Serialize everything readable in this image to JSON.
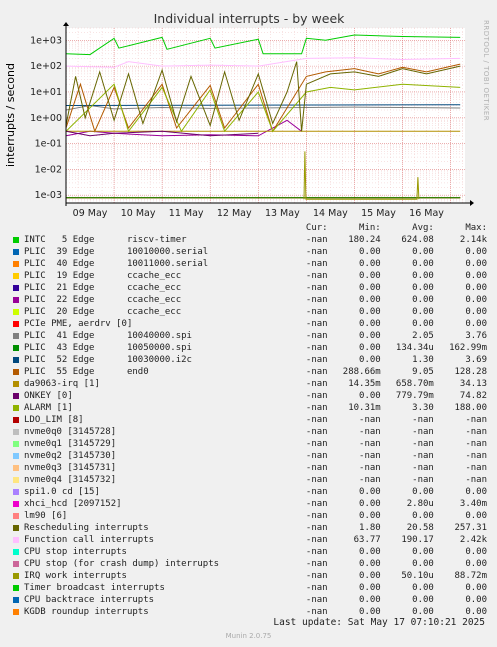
{
  "chart_data": {
    "type": "line",
    "title": "Individual interrupts - by week",
    "ylabel": "interrupts / second",
    "yscale": "log",
    "ylim": [
      0.0005,
      3000
    ],
    "yticks": [
      "1e+03",
      "1e+02",
      "1e+01",
      "1e+00",
      "1e-01",
      "1e-02",
      "1e-03"
    ],
    "ytick_values": [
      1000,
      100,
      10,
      1,
      0.1,
      0.01,
      0.001
    ],
    "xticks": [
      "09 May",
      "10 May",
      "11 May",
      "12 May",
      "13 May",
      "14 May",
      "15 May",
      "16 May"
    ],
    "xlim_days": [
      0,
      8.3
    ],
    "grid": true,
    "watermark": "RRDTOOL / TOBI OETIKER",
    "series": [
      {
        "name": "INTC   5 Edge      riscv-timer",
        "color": "#00cc00",
        "points": [
          [
            0,
            300
          ],
          [
            0.5,
            280
          ],
          [
            1.0,
            1200
          ],
          [
            1.1,
            500
          ],
          [
            2.0,
            1300
          ],
          [
            2.1,
            450
          ],
          [
            3.0,
            1200
          ],
          [
            3.1,
            500
          ],
          [
            4.0,
            1100
          ],
          [
            4.1,
            300
          ],
          [
            4.9,
            300
          ],
          [
            5.0,
            1200
          ],
          [
            5.4,
            1000
          ],
          [
            6.0,
            1600
          ],
          [
            7.0,
            1400
          ],
          [
            8.2,
            1300
          ]
        ]
      },
      {
        "name": "PLIC  39 Edge      10010000.serial",
        "color": "#0066b3",
        "points": [
          [
            0,
            0.0008
          ],
          [
            8.2,
            0.0008
          ]
        ]
      },
      {
        "name": "PLIC  40 Edge      10011000.serial",
        "color": "#ff8000",
        "points": [
          [
            0,
            0.0008
          ],
          [
            8.2,
            0.0008
          ]
        ]
      },
      {
        "name": "PLIC  19 Edge      ccache_ecc",
        "color": "#ffcc00",
        "points": [
          [
            0,
            0.0008
          ],
          [
            8.2,
            0.0008
          ]
        ]
      },
      {
        "name": "PLIC  21 Edge      ccache_ecc",
        "color": "#330099",
        "points": [
          [
            0,
            0.0008
          ],
          [
            8.2,
            0.0008
          ]
        ]
      },
      {
        "name": "PLIC  22 Edge      ccache_ecc",
        "color": "#990099",
        "points": [
          [
            0,
            0.2
          ],
          [
            0.5,
            0.3
          ],
          [
            1.0,
            0.25
          ],
          [
            2.0,
            0.2
          ],
          [
            3.0,
            0.22
          ],
          [
            4.0,
            0.2
          ],
          [
            4.6,
            0.8
          ],
          [
            4.9,
            0.3
          ]
        ]
      },
      {
        "name": "PLIC  20 Edge      ccache_ecc",
        "color": "#ccff00",
        "points": [
          [
            0,
            0.0008
          ],
          [
            8.2,
            0.0008
          ]
        ]
      },
      {
        "name": "PCIe PME, aerdrv [0]",
        "color": "#ff0000",
        "points": [
          [
            0,
            0.0008
          ],
          [
            8.2,
            0.0008
          ]
        ]
      },
      {
        "name": "PLIC  41 Edge      10040000.spi",
        "color": "#808080",
        "points": [
          [
            0,
            2.0
          ],
          [
            0.5,
            3.0
          ],
          [
            1.0,
            2.2
          ],
          [
            2.0,
            2.5
          ],
          [
            3.0,
            2.3
          ],
          [
            4.0,
            2.4
          ],
          [
            5.0,
            2.5
          ],
          [
            6.0,
            2.6
          ],
          [
            7.0,
            2.5
          ],
          [
            8.2,
            2.4
          ]
        ]
      },
      {
        "name": "PLIC  43 Edge      10050000.spi",
        "color": "#008f00",
        "points": [
          [
            0,
            0.0008
          ],
          [
            8.2,
            0.0008
          ]
        ]
      },
      {
        "name": "PLIC  52 Edge      10030000.i2c",
        "color": "#00487d",
        "points": [
          [
            0,
            3.0
          ],
          [
            8.2,
            3.2
          ]
        ]
      },
      {
        "name": "PLIC  55 Edge      end0",
        "color": "#b35a00",
        "points": [
          [
            0,
            0.4
          ],
          [
            0.3,
            20
          ],
          [
            0.6,
            0.3
          ],
          [
            1.0,
            15
          ],
          [
            1.3,
            0.4
          ],
          [
            2.0,
            20
          ],
          [
            2.3,
            0.4
          ],
          [
            3.0,
            18
          ],
          [
            3.3,
            0.4
          ],
          [
            4.0,
            20
          ],
          [
            4.3,
            0.3
          ],
          [
            5.0,
            40
          ],
          [
            5.4,
            60
          ],
          [
            6.0,
            80
          ],
          [
            6.5,
            50
          ],
          [
            7.0,
            90
          ],
          [
            7.5,
            60
          ],
          [
            8.2,
            120
          ]
        ]
      },
      {
        "name": "da9063-irq [1]",
        "color": "#b38f00",
        "points": [
          [
            0,
            0.3
          ],
          [
            8.2,
            0.3
          ]
        ]
      },
      {
        "name": "ONKEY [0]",
        "color": "#6b006b",
        "points": [
          [
            0,
            0.3
          ],
          [
            0.5,
            0.2
          ],
          [
            1.0,
            0.25
          ],
          [
            2.0,
            0.3
          ],
          [
            3.0,
            0.2
          ],
          [
            4.0,
            0.25
          ]
        ]
      },
      {
        "name": "ALARM [1]",
        "color": "#8fb300",
        "points": [
          [
            0,
            0.3
          ],
          [
            1.0,
            20
          ],
          [
            1.3,
            0.3
          ],
          [
            2.0,
            15
          ],
          [
            2.4,
            0.3
          ],
          [
            3.0,
            12
          ],
          [
            3.3,
            0.3
          ],
          [
            4.0,
            10
          ],
          [
            4.3,
            0.3
          ],
          [
            5.0,
            10
          ],
          [
            5.5,
            15
          ],
          [
            6.0,
            12
          ],
          [
            7.0,
            20
          ],
          [
            8.2,
            15
          ]
        ]
      },
      {
        "name": "LDO_LIM [8]",
        "color": "#b30000",
        "points": []
      },
      {
        "name": "nvme0q0 [3145728]",
        "color": "#bebebe",
        "points": []
      },
      {
        "name": "nvme0q1 [3145729]",
        "color": "#80ff80",
        "points": []
      },
      {
        "name": "nvme0q2 [3145730]",
        "color": "#80c9ff",
        "points": []
      },
      {
        "name": "nvme0q3 [3145731]",
        "color": "#ffc080",
        "points": []
      },
      {
        "name": "nvme0q4 [3145732]",
        "color": "#ffe680",
        "points": []
      },
      {
        "name": "spi1.0 cd [15]",
        "color": "#aa80ff",
        "points": []
      },
      {
        "name": "xhci_hcd [2097152]",
        "color": "#ee00cc",
        "points": []
      },
      {
        "name": "lm90 [6]",
        "color": "#ff8080",
        "points": []
      },
      {
        "name": "Rescheduling interrupts",
        "color": "#666600",
        "points": [
          [
            0,
            0.5
          ],
          [
            0.2,
            40
          ],
          [
            0.4,
            1.0
          ],
          [
            0.7,
            60
          ],
          [
            1.0,
            0.8
          ],
          [
            1.3,
            50
          ],
          [
            1.6,
            0.6
          ],
          [
            2.0,
            70
          ],
          [
            2.3,
            0.7
          ],
          [
            2.6,
            40
          ],
          [
            3.0,
            0.5
          ],
          [
            3.3,
            60
          ],
          [
            3.6,
            0.8
          ],
          [
            4.0,
            50
          ],
          [
            4.3,
            0.6
          ],
          [
            4.6,
            10
          ],
          [
            4.8,
            150
          ],
          [
            4.9,
            0.3
          ],
          [
            5.0,
            20
          ],
          [
            5.5,
            50
          ],
          [
            6.0,
            60
          ],
          [
            6.5,
            40
          ],
          [
            7.0,
            80
          ],
          [
            7.5,
            50
          ],
          [
            8.2,
            100
          ]
        ]
      },
      {
        "name": "Function call interrupts",
        "color": "#ffbfff",
        "points": [
          [
            0,
            100
          ],
          [
            1.0,
            90
          ],
          [
            1.3,
            150
          ],
          [
            2.0,
            100
          ],
          [
            3.0,
            110
          ],
          [
            4.0,
            100
          ],
          [
            5.0,
            200
          ],
          [
            6.0,
            210
          ],
          [
            7.0,
            180
          ],
          [
            8.2,
            200
          ]
        ]
      },
      {
        "name": "CPU stop interrupts",
        "color": "#00ffcc",
        "points": []
      },
      {
        "name": "CPU stop (for crash dump) interrupts",
        "color": "#cc6699",
        "points": []
      },
      {
        "name": "IRQ work interrupts",
        "color": "#999900",
        "points": [
          [
            4.95,
            0.0007
          ],
          [
            4.97,
            0.05
          ],
          [
            4.99,
            0.0007
          ],
          [
            7.3,
            0.0007
          ],
          [
            7.32,
            0.005
          ],
          [
            7.34,
            0.0007
          ]
        ]
      },
      {
        "name": "Timer broadcast interrupts",
        "color": "#00cc00",
        "points": []
      },
      {
        "name": "CPU backtrace interrupts",
        "color": "#0066b3",
        "points": []
      },
      {
        "name": "KGDB roundup interrupts",
        "color": "#ff8000",
        "points": []
      }
    ]
  },
  "legend": {
    "headers": [
      "Cur:",
      "Min:",
      "Avg:",
      "Max:"
    ],
    "rows": [
      {
        "name": "INTC   5 Edge      riscv-timer",
        "cur": "-nan",
        "min": "180.24",
        "avg": "624.08",
        "max": "2.14k"
      },
      {
        "name": "PLIC  39 Edge      10010000.serial",
        "cur": "-nan",
        "min": "0.00",
        "avg": "0.00",
        "max": "0.00"
      },
      {
        "name": "PLIC  40 Edge      10011000.serial",
        "cur": "-nan",
        "min": "0.00",
        "avg": "0.00",
        "max": "0.00"
      },
      {
        "name": "PLIC  19 Edge      ccache_ecc",
        "cur": "-nan",
        "min": "0.00",
        "avg": "0.00",
        "max": "0.00"
      },
      {
        "name": "PLIC  21 Edge      ccache_ecc",
        "cur": "-nan",
        "min": "0.00",
        "avg": "0.00",
        "max": "0.00"
      },
      {
        "name": "PLIC  22 Edge      ccache_ecc",
        "cur": "-nan",
        "min": "0.00",
        "avg": "0.00",
        "max": "0.00"
      },
      {
        "name": "PLIC  20 Edge      ccache_ecc",
        "cur": "-nan",
        "min": "0.00",
        "avg": "0.00",
        "max": "0.00"
      },
      {
        "name": "PCIe PME, aerdrv [0]",
        "cur": "-nan",
        "min": "0.00",
        "avg": "0.00",
        "max": "0.00"
      },
      {
        "name": "PLIC  41 Edge      10040000.spi",
        "cur": "-nan",
        "min": "0.00",
        "avg": "2.05",
        "max": "3.76"
      },
      {
        "name": "PLIC  43 Edge      10050000.spi",
        "cur": "-nan",
        "min": "0.00",
        "avg": "134.34u",
        "max": "162.99m"
      },
      {
        "name": "PLIC  52 Edge      10030000.i2c",
        "cur": "-nan",
        "min": "0.00",
        "avg": "1.30",
        "max": "3.69"
      },
      {
        "name": "PLIC  55 Edge      end0",
        "cur": "-nan",
        "min": "288.66m",
        "avg": "9.05",
        "max": "128.28"
      },
      {
        "name": "da9063-irq [1]",
        "cur": "-nan",
        "min": "14.35m",
        "avg": "658.70m",
        "max": "34.13"
      },
      {
        "name": "ONKEY [0]",
        "cur": "-nan",
        "min": "0.00",
        "avg": "779.79m",
        "max": "74.82"
      },
      {
        "name": "ALARM [1]",
        "cur": "-nan",
        "min": "10.31m",
        "avg": "3.30",
        "max": "188.00"
      },
      {
        "name": "LDO_LIM [8]",
        "cur": "-nan",
        "min": "-nan",
        "avg": "-nan",
        "max": "-nan"
      },
      {
        "name": "nvme0q0 [3145728]",
        "cur": "-nan",
        "min": "-nan",
        "avg": "-nan",
        "max": "-nan"
      },
      {
        "name": "nvme0q1 [3145729]",
        "cur": "-nan",
        "min": "-nan",
        "avg": "-nan",
        "max": "-nan"
      },
      {
        "name": "nvme0q2 [3145730]",
        "cur": "-nan",
        "min": "-nan",
        "avg": "-nan",
        "max": "-nan"
      },
      {
        "name": "nvme0q3 [3145731]",
        "cur": "-nan",
        "min": "-nan",
        "avg": "-nan",
        "max": "-nan"
      },
      {
        "name": "nvme0q4 [3145732]",
        "cur": "-nan",
        "min": "-nan",
        "avg": "-nan",
        "max": "-nan"
      },
      {
        "name": "spi1.0 cd [15]",
        "cur": "-nan",
        "min": "0.00",
        "avg": "0.00",
        "max": "0.00"
      },
      {
        "name": "xhci_hcd [2097152]",
        "cur": "-nan",
        "min": "0.00",
        "avg": "2.80u",
        "max": "3.40m"
      },
      {
        "name": "lm90 [6]",
        "cur": "-nan",
        "min": "0.00",
        "avg": "0.00",
        "max": "0.00"
      },
      {
        "name": "Rescheduling interrupts",
        "cur": "-nan",
        "min": "1.80",
        "avg": "20.58",
        "max": "257.31"
      },
      {
        "name": "Function call interrupts",
        "cur": "-nan",
        "min": "63.77",
        "avg": "190.17",
        "max": "2.42k"
      },
      {
        "name": "CPU stop interrupts",
        "cur": "-nan",
        "min": "0.00",
        "avg": "0.00",
        "max": "0.00"
      },
      {
        "name": "CPU stop (for crash dump) interrupts",
        "cur": "-nan",
        "min": "0.00",
        "avg": "0.00",
        "max": "0.00"
      },
      {
        "name": "IRQ work interrupts",
        "cur": "-nan",
        "min": "0.00",
        "avg": "50.10u",
        "max": "88.72m"
      },
      {
        "name": "Timer broadcast interrupts",
        "cur": "-nan",
        "min": "0.00",
        "avg": "0.00",
        "max": "0.00"
      },
      {
        "name": "CPU backtrace interrupts",
        "cur": "-nan",
        "min": "0.00",
        "avg": "0.00",
        "max": "0.00"
      },
      {
        "name": "KGDB roundup interrupts",
        "cur": "-nan",
        "min": "0.00",
        "avg": "0.00",
        "max": "0.00"
      }
    ]
  },
  "last_update": "Last update: Sat May 17 07:10:21 2025",
  "footer": "Munin 2.0.75"
}
